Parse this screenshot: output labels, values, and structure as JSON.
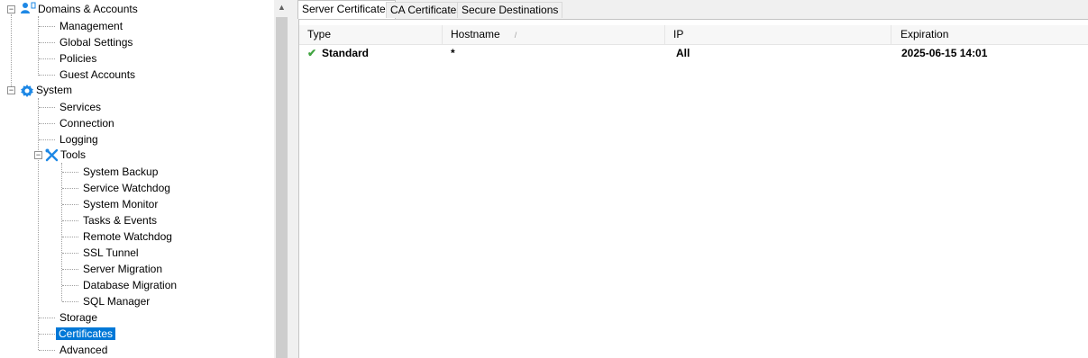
{
  "tree": {
    "domains": "Domains & Accounts",
    "management": "Management",
    "global_settings": "Global Settings",
    "policies": "Policies",
    "guest_accounts": "Guest Accounts",
    "system": "System",
    "services": "Services",
    "connection": "Connection",
    "logging": "Logging",
    "tools": "Tools",
    "system_backup": "System Backup",
    "service_watchdog": "Service Watchdog",
    "system_monitor": "System Monitor",
    "tasks_events": "Tasks & Events",
    "remote_watchdog": "Remote Watchdog",
    "ssl_tunnel": "SSL Tunnel",
    "server_migration": "Server Migration",
    "database_migration": "Database Migration",
    "sql_manager": "SQL Manager",
    "storage": "Storage",
    "certificates": "Certificates",
    "advanced": "Advanced",
    "collapse_glyph": "−"
  },
  "scrollbar": {
    "up_glyph": "▲"
  },
  "tabs": {
    "server_certificates": "Server Certificates",
    "ca_certificates": "CA Certificates",
    "secure_destinations": "Secure Destinations"
  },
  "grid": {
    "columns": {
      "type": "Type",
      "hostname": "Hostname",
      "ip": "IP",
      "expiration": "Expiration"
    },
    "sort_glyph": "/",
    "rows": [
      {
        "status_glyph": "✔",
        "type": "Standard",
        "hostname": "*",
        "ip": "All",
        "expiration": "2025-06-15 14:01"
      }
    ]
  },
  "colors": {
    "selection": "#0078d7",
    "check": "#3fa33f",
    "icon_blue": "#1e88e5"
  }
}
